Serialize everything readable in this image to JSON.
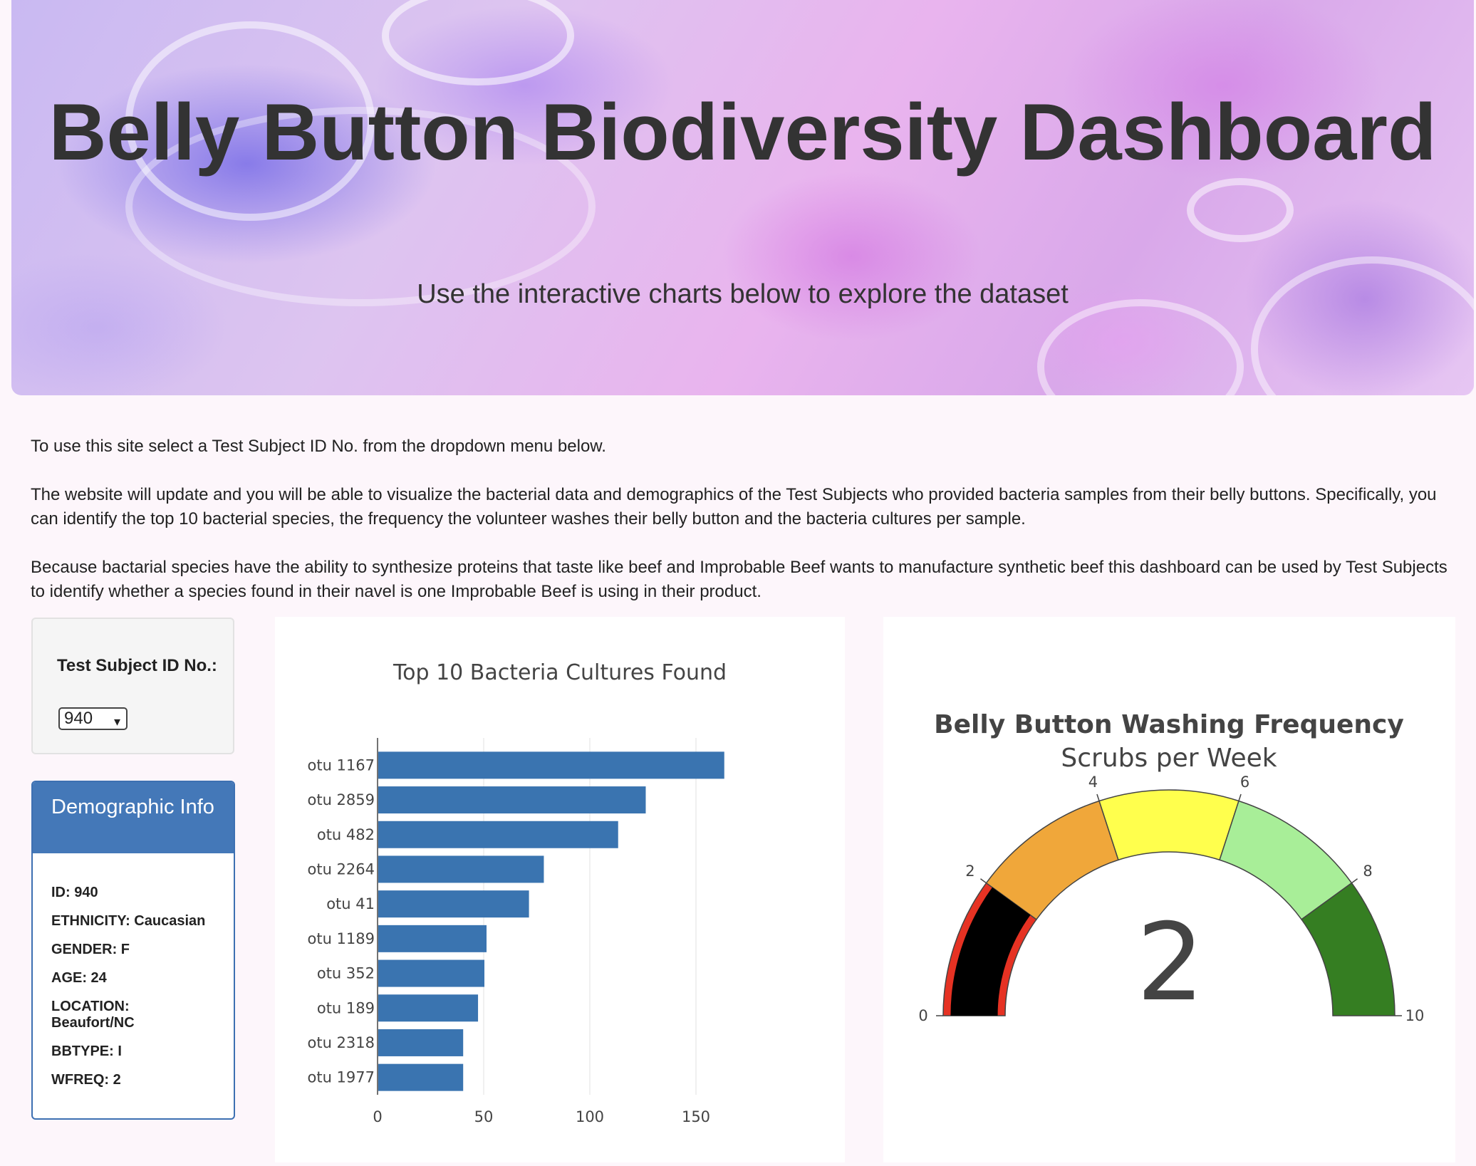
{
  "header": {
    "title": "Belly Button Biodiversity Dashboard",
    "subtitle": "Use the interactive charts below to explore the dataset"
  },
  "intro": {
    "p1": "To use this site select a Test Subject ID No. from the dropdown menu below.",
    "p2": "The website will update and you will be able to visualize the bacterial data and demographics of the Test Subjects who provided bacteria samples from their belly buttons. Specifically, you can identify the top 10 bacterial species, the frequency the volunteer washes their belly button and the bacteria cultures per sample.",
    "p3": "Because bactarial species have the ability to synthesize proteins that taste like beef and Improbable Beef wants to manufacture synthetic beef this dashboard can be used by Test Subjects to identify whether a species found in their navel is one Improbable Beef is using in their product."
  },
  "selector": {
    "label": "Test Subject ID No.:",
    "value": "940",
    "chevron": "▾"
  },
  "demographics": {
    "title": "Demographic Info",
    "rows": [
      "ID: 940",
      "ETHNICITY: Caucasian",
      "GENDER: F",
      "AGE: 24",
      "LOCATION: Beaufort/NC",
      "BBTYPE: I",
      "WFREQ: 2"
    ]
  },
  "chart_data": [
    {
      "type": "bar",
      "orientation": "horizontal",
      "title": "Top 10 Bacteria Cultures Found",
      "categories": [
        "otu 1167",
        "otu 2859",
        "otu 482",
        "otu 2264",
        "otu 41",
        "otu 1189",
        "otu 352",
        "otu 189",
        "otu 2318",
        "otu 1977"
      ],
      "values": [
        163,
        126,
        113,
        78,
        71,
        51,
        50,
        47,
        40,
        40
      ],
      "xlim": [
        0,
        170
      ],
      "xticks": [
        0,
        50,
        100,
        150
      ],
      "grid": true,
      "color": "#3a74b0"
    },
    {
      "type": "gauge",
      "title": "Belly Button Washing Frequency",
      "subtitle": "Scrubs per Week",
      "value": 2,
      "range": [
        0,
        10
      ],
      "ticks": [
        0,
        2,
        4,
        6,
        8,
        10
      ],
      "bands": [
        {
          "from": 0,
          "to": 2,
          "color": "#e63223"
        },
        {
          "from": 2,
          "to": 4,
          "color": "#f0a73a"
        },
        {
          "from": 4,
          "to": 6,
          "color": "#ffff4d"
        },
        {
          "from": 6,
          "to": 8,
          "color": "#a8ee98"
        },
        {
          "from": 8,
          "to": 10,
          "color": "#357e22"
        }
      ],
      "bar_color": "#000000"
    }
  ]
}
